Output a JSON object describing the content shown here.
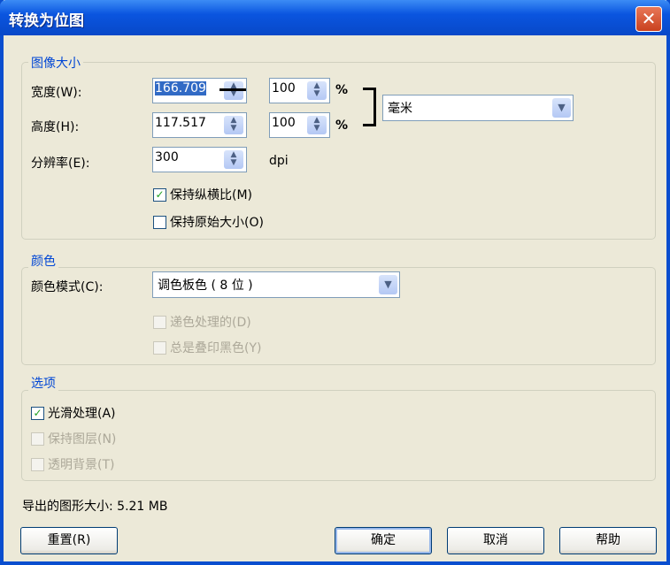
{
  "window": {
    "title": "转换为位图",
    "close_label": "✕"
  },
  "image_size": {
    "legend": "图像大小",
    "width_label": "宽度(W):",
    "width_value": "166.709",
    "width_percent": "100",
    "height_label": "高度(H):",
    "height_value": "117.517",
    "height_percent": "100",
    "percent_sign": "%",
    "resolution_label": "分辨率(E):",
    "resolution_value": "300",
    "resolution_unit": "dpi",
    "units_value": "毫米",
    "keep_aspect_label": "保持纵横比(M)",
    "keep_aspect_checked": true,
    "keep_original_label": "保持原始大小(O)",
    "keep_original_checked": false
  },
  "color": {
    "legend": "颜色",
    "mode_label": "颜色模式(C):",
    "mode_value": "调色板色 ( 8 位 )",
    "dither_label": "递色处理的(D)",
    "overprint_label": "总是叠印黑色(Y)"
  },
  "options": {
    "legend": "选项",
    "antialias_label": "光滑处理(A)",
    "antialias_checked": true,
    "keep_layers_label": "保持图层(N)",
    "transparent_label": "透明背景(T)"
  },
  "export_size": "导出的图形大小: 5.21 MB",
  "buttons": {
    "reset": "重置(R)",
    "ok": "确定",
    "cancel": "取消",
    "help": "帮助"
  }
}
